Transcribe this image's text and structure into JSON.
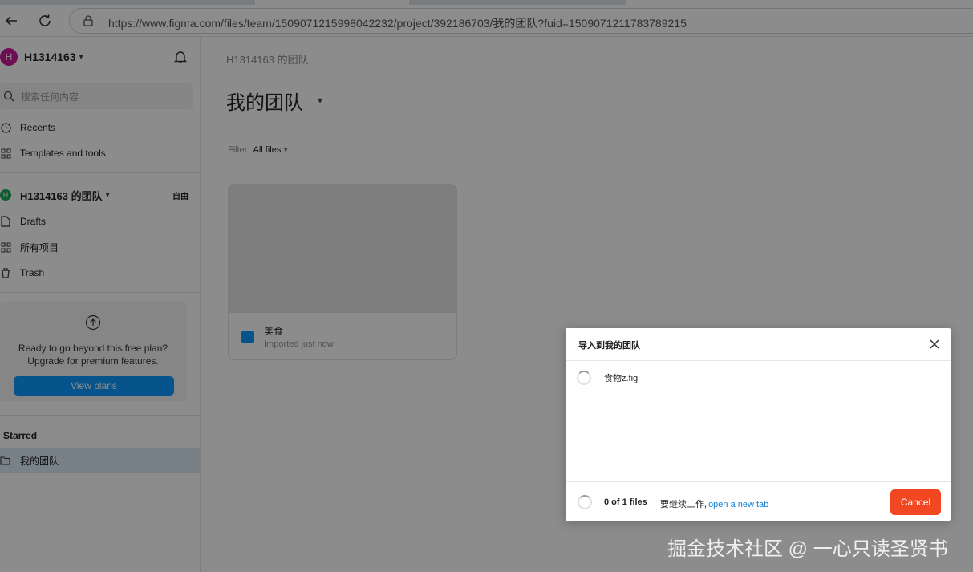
{
  "browser": {
    "url": "https://www.figma.com/files/team/1509071215998042232/project/392186703/我的团队?fuid=1509071211783789215"
  },
  "sidebar": {
    "user": {
      "initial": "H",
      "name": "H1314163"
    },
    "search_placeholder": "搜索任何内容",
    "nav": [
      {
        "label": "Recents",
        "icon": "clock-icon"
      },
      {
        "label": "Templates and tools",
        "icon": "grid-icon"
      }
    ],
    "team": {
      "initial": "H",
      "name": "H1314163 的团队",
      "badge": "自由"
    },
    "team_nav": [
      {
        "label": "Drafts",
        "icon": "file-icon"
      },
      {
        "label": "所有项目",
        "icon": "grid-icon"
      },
      {
        "label": "Trash",
        "icon": "trash-icon"
      }
    ],
    "upgrade": {
      "line1": "Ready to go beyond this free plan?",
      "line2": "Upgrade for premium features.",
      "button": "View plans"
    },
    "starred": {
      "title": "Starred",
      "items": [
        {
          "label": "我的团队",
          "icon": "folder-icon"
        }
      ]
    }
  },
  "main": {
    "breadcrumb": "H1314163 的团队",
    "title": "我的团队",
    "filter_label": "Filter:",
    "filter_value": "All files",
    "files": [
      {
        "name": "美食",
        "subtitle": "Imported just now"
      }
    ]
  },
  "modal": {
    "title": "导入到我的团队",
    "files": [
      {
        "name": "食物z.fig"
      }
    ],
    "progress": "0 of 1 files",
    "continue_prefix": "要继续工作,",
    "continue_link": "open a new tab",
    "cancel": "Cancel"
  },
  "watermark": "掘金技术社区 @ 一心只读圣贤书",
  "colors": {
    "accent": "#0d99ff",
    "cancel": "#f24822",
    "avatar": "#c7189a",
    "team_avatar": "#20a65a"
  }
}
